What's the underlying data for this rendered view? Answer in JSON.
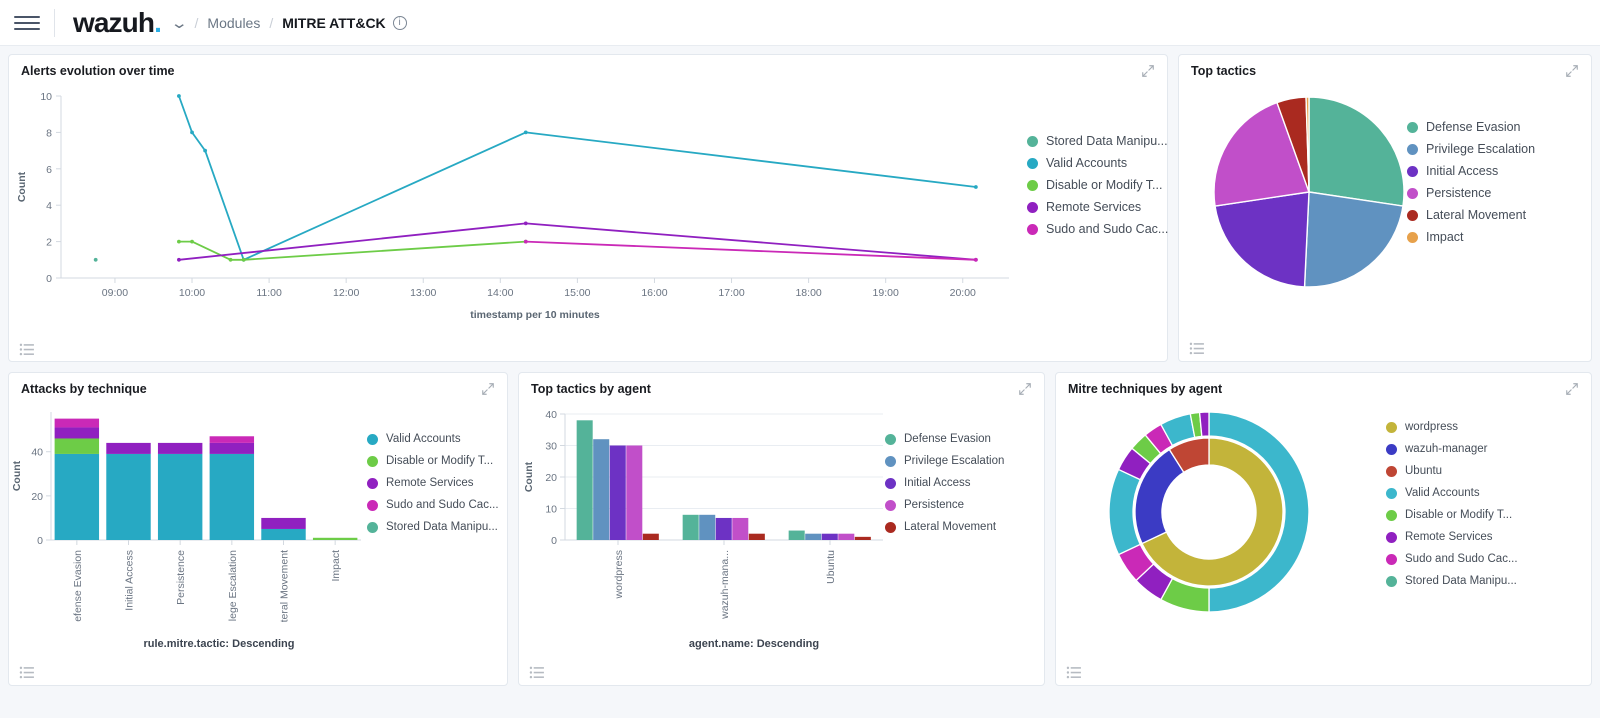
{
  "header": {
    "brand": "wazuh",
    "brand_dot": ".",
    "chevron": "⌄",
    "breadcrumb_modules": "Modules",
    "breadcrumb_current": "MITRE ATT&CK",
    "info_glyph": "i",
    "sep": "/"
  },
  "colors": {
    "green": "#54b399",
    "cyan": "#27a9c3",
    "lightgreen": "#6dcc47",
    "purple": "#9020c0",
    "magenta": "#ca29b7",
    "blue": "#6092c0",
    "indigo": "#6d32c4",
    "orchid": "#c14fc9",
    "darkred": "#aa2a20",
    "orange": "#e7a14b",
    "yellow": "#c3b43a",
    "royal": "#3b3bc4",
    "brick": "#bf4634",
    "teal": "#3cb7cc"
  },
  "panels": {
    "alerts": {
      "title": "Alerts evolution over time",
      "expand_label": "Expand",
      "list_label": "Inspect"
    },
    "tactics": {
      "title": "Top tactics"
    },
    "attacks": {
      "title": "Attacks by technique"
    },
    "tactics_by_agent": {
      "title": "Top tactics by agent"
    },
    "mitre_by_agent": {
      "title": "Mitre techniques by agent"
    }
  },
  "chart_data": [
    {
      "type": "line",
      "title": "Alerts evolution over time",
      "xlabel": "timestamp per 10 minutes",
      "ylabel": "Count",
      "ylim": [
        0,
        10
      ],
      "yticks": [
        0,
        2,
        4,
        6,
        8,
        10
      ],
      "xticks": [
        "09:00",
        "10:00",
        "11:00",
        "12:00",
        "13:00",
        "14:00",
        "15:00",
        "16:00",
        "17:00",
        "18:00",
        "19:00",
        "20:00"
      ],
      "grid": false,
      "legend_position": "right",
      "series": [
        {
          "name": "Stored Data Manipu...",
          "color": "#54b399",
          "points": [
            [
              8.75,
              1
            ]
          ]
        },
        {
          "name": "Valid Accounts",
          "color": "#27a9c3",
          "points": [
            [
              9.83,
              10
            ],
            [
              10.0,
              8
            ],
            [
              10.17,
              7
            ],
            [
              10.67,
              1
            ],
            [
              14.33,
              8
            ],
            [
              20.17,
              5
            ]
          ]
        },
        {
          "name": "Disable or Modify T...",
          "color": "#6dcc47",
          "points": [
            [
              9.83,
              2
            ],
            [
              10.0,
              2
            ],
            [
              10.5,
              1
            ],
            [
              10.67,
              1
            ],
            [
              14.33,
              2
            ]
          ]
        },
        {
          "name": "Remote Services",
          "color": "#9020c0",
          "points": [
            [
              9.83,
              1
            ],
            [
              14.33,
              3
            ],
            [
              20.17,
              1
            ]
          ]
        },
        {
          "name": "Sudo and Sudo Cac...",
          "color": "#ca29b7",
          "points": [
            [
              14.33,
              2
            ],
            [
              20.17,
              1
            ]
          ]
        }
      ]
    },
    {
      "type": "pie",
      "title": "Top tactics",
      "legend_position": "right",
      "labels": [
        "Defense Evasion",
        "Privilege Escalation",
        "Initial Access",
        "Persistence",
        "Lateral Movement",
        "Impact"
      ],
      "colors": [
        "#54b399",
        "#6092c0",
        "#6d32c4",
        "#c14fc9",
        "#aa2a20",
        "#e7a14b"
      ],
      "values": [
        55,
        47,
        44,
        44,
        10,
        1
      ]
    },
    {
      "type": "bar",
      "subtype": "stacked",
      "title": "Attacks by technique",
      "xlabel": "rule.mitre.tactic: Descending",
      "ylabel": "Count",
      "ylim": [
        0,
        58
      ],
      "yticks": [
        0,
        20,
        40
      ],
      "categories": [
        "Defense Evasion",
        "Initial Access",
        "Persistence",
        "Privilege Escalation",
        "Lateral Movement",
        "Impact"
      ],
      "series": [
        {
          "name": "Valid Accounts",
          "color": "#27a9c3",
          "values": [
            39,
            39,
            39,
            39,
            5,
            0
          ]
        },
        {
          "name": "Disable or Modify T...",
          "color": "#6dcc47",
          "values": [
            7,
            0,
            0,
            0,
            0,
            1
          ]
        },
        {
          "name": "Remote Services",
          "color": "#9020c0",
          "values": [
            5,
            5,
            5,
            5,
            5,
            0
          ]
        },
        {
          "name": "Sudo and Sudo Cac...",
          "color": "#ca29b7",
          "values": [
            4,
            0,
            0,
            3,
            0,
            0
          ]
        },
        {
          "name": "Stored Data Manipu...",
          "color": "#54b399",
          "values": [
            0,
            0,
            0,
            0,
            0,
            0
          ]
        }
      ]
    },
    {
      "type": "bar",
      "subtype": "grouped",
      "title": "Top tactics by agent",
      "xlabel": "agent.name: Descending",
      "ylabel": "Count",
      "ylim": [
        0,
        40
      ],
      "yticks": [
        0,
        10,
        20,
        30,
        40
      ],
      "categories": [
        "wordpress",
        "wazuh-mana...",
        "Ubuntu"
      ],
      "series": [
        {
          "name": "Defense Evasion",
          "color": "#54b399",
          "values": [
            38,
            8,
            3
          ]
        },
        {
          "name": "Privilege Escalation",
          "color": "#6092c0",
          "values": [
            32,
            8,
            2
          ]
        },
        {
          "name": "Initial Access",
          "color": "#6d32c4",
          "values": [
            30,
            7,
            2
          ]
        },
        {
          "name": "Persistence",
          "color": "#c14fc9",
          "values": [
            30,
            7,
            2
          ]
        },
        {
          "name": "Lateral Movement",
          "color": "#aa2a20",
          "values": [
            2,
            2,
            1
          ]
        }
      ]
    },
    {
      "type": "pie",
      "subtype": "donut-nested",
      "title": "Mitre techniques by agent",
      "legend_position": "right",
      "inner": {
        "labels": [
          "wordpress",
          "wazuh-manager",
          "Ubuntu"
        ],
        "colors": [
          "#c3b43a",
          "#3b3bc4",
          "#bf4634"
        ],
        "values": [
          68,
          23,
          9
        ]
      },
      "outer": {
        "labels": [
          "Valid Accounts",
          "Disable or Modify T...",
          "Remote Services",
          "Sudo and Sudo Cac...",
          "Stored Data Manipu..."
        ],
        "colors": [
          "#3cb7cc",
          "#6dcc47",
          "#9020c0",
          "#ca29b7",
          "#54b399"
        ],
        "segments": [
          {
            "label": "Valid Accounts",
            "color": "#3cb7cc",
            "value": 50
          },
          {
            "label": "Disable or Modify T...",
            "color": "#6dcc47",
            "value": 8
          },
          {
            "label": "Remote Services",
            "color": "#9020c0",
            "value": 5
          },
          {
            "label": "Sudo and Sudo Cac...",
            "color": "#ca29b7",
            "value": 5
          },
          {
            "label": "Valid Accounts",
            "color": "#3cb7cc",
            "value": 14
          },
          {
            "label": "Remote Services",
            "color": "#9020c0",
            "value": 4
          },
          {
            "label": "Disable or Modify T...",
            "color": "#6dcc47",
            "value": 3
          },
          {
            "label": "Sudo and Sudo Cac...",
            "color": "#ca29b7",
            "value": 3
          },
          {
            "label": "Valid Accounts",
            "color": "#3cb7cc",
            "value": 5
          },
          {
            "label": "Disable or Modify T...",
            "color": "#6dcc47",
            "value": 1.5
          },
          {
            "label": "Remote Services",
            "color": "#9020c0",
            "value": 1.5
          }
        ]
      },
      "legend": [
        {
          "label": "wordpress",
          "color": "#c3b43a"
        },
        {
          "label": "wazuh-manager",
          "color": "#3b3bc4"
        },
        {
          "label": "Ubuntu",
          "color": "#bf4634"
        },
        {
          "label": "Valid Accounts",
          "color": "#3cb7cc"
        },
        {
          "label": "Disable or Modify T...",
          "color": "#6dcc47"
        },
        {
          "label": "Remote Services",
          "color": "#9020c0"
        },
        {
          "label": "Sudo and Sudo Cac...",
          "color": "#ca29b7"
        },
        {
          "label": "Stored Data Manipu...",
          "color": "#54b399"
        }
      ]
    }
  ]
}
